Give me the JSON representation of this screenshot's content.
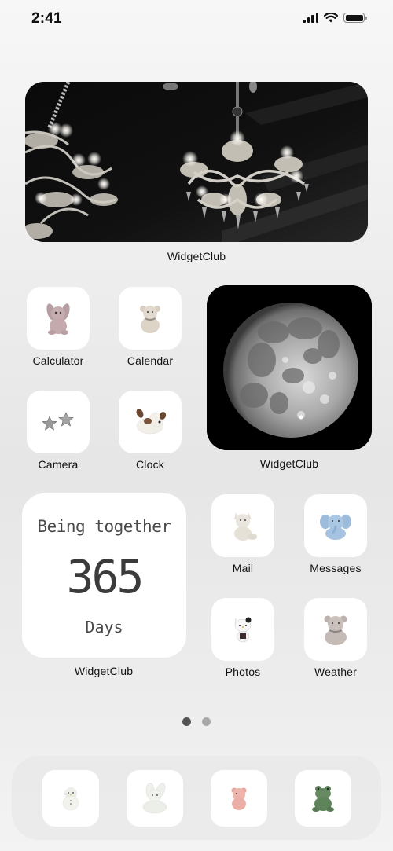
{
  "status_bar": {
    "time": "2:41",
    "signal_bars": 4,
    "wifi": "wifi-full",
    "battery_percent": 100
  },
  "widgets": {
    "chandelier": {
      "label": "WidgetClub",
      "image": "black-and-white chandelier photo"
    },
    "moon": {
      "label": "WidgetClub",
      "image": "full moon photo"
    },
    "counter": {
      "label": "WidgetClub",
      "title": "Being together",
      "value": "365",
      "unit": "Days"
    }
  },
  "apps": [
    {
      "label": "Calculator",
      "icon": "pink-bunny-plush-icon"
    },
    {
      "label": "Calendar",
      "icon": "cream-teddy-bear-plush-icon"
    },
    {
      "label": "Camera",
      "icon": "silver-stars-icon"
    },
    {
      "label": "Clock",
      "icon": "spotted-puppy-plush-icon"
    },
    {
      "label": "Mail",
      "icon": "white-kitten-plush-icon"
    },
    {
      "label": "Messages",
      "icon": "blue-elephant-plush-icon"
    },
    {
      "label": "Photos",
      "icon": "hello-kitty-plush-icon"
    },
    {
      "label": "Weather",
      "icon": "grey-teddy-bear-plush-icon"
    }
  ],
  "page_indicator": {
    "pages": 2,
    "current": 1,
    "active_color": "#555555",
    "inactive_color": "#a8a8a8"
  },
  "dock": [
    {
      "icon": "penguin-plush-icon"
    },
    {
      "icon": "white-bunny-plush-icon"
    },
    {
      "icon": "pink-bear-plush-icon"
    },
    {
      "icon": "green-frog-plush-icon"
    }
  ]
}
